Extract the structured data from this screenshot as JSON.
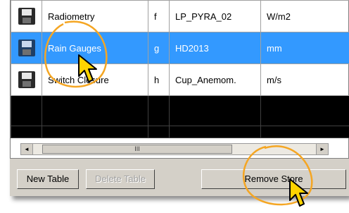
{
  "rows": [
    {
      "name": "Radiometry",
      "letter": "f",
      "sensor": "LP_PYRA_02",
      "unit": "W/m2",
      "icon": "floppy-disk-icon",
      "selected": false
    },
    {
      "name": "Rain Gauges",
      "letter": "g",
      "sensor": "HD2013",
      "unit": "mm",
      "icon": "floppy-disk-icon",
      "selected": true
    },
    {
      "name": "Switch Closure",
      "letter": "h",
      "sensor": "Cup_Anemom.",
      "unit": "m/s",
      "icon": "floppy-disk-icon",
      "selected": false
    }
  ],
  "scrollbar": {
    "left_arrow": "◄",
    "right_arrow": "►",
    "thumb_grip": "III"
  },
  "buttons": {
    "new_table": "New Table",
    "delete_table": "Delete Table",
    "remove_store": "Remove Store"
  },
  "colors": {
    "selection": "#3399ff",
    "highlight_circle": "#f5a623",
    "cursor": "#ffd400"
  }
}
